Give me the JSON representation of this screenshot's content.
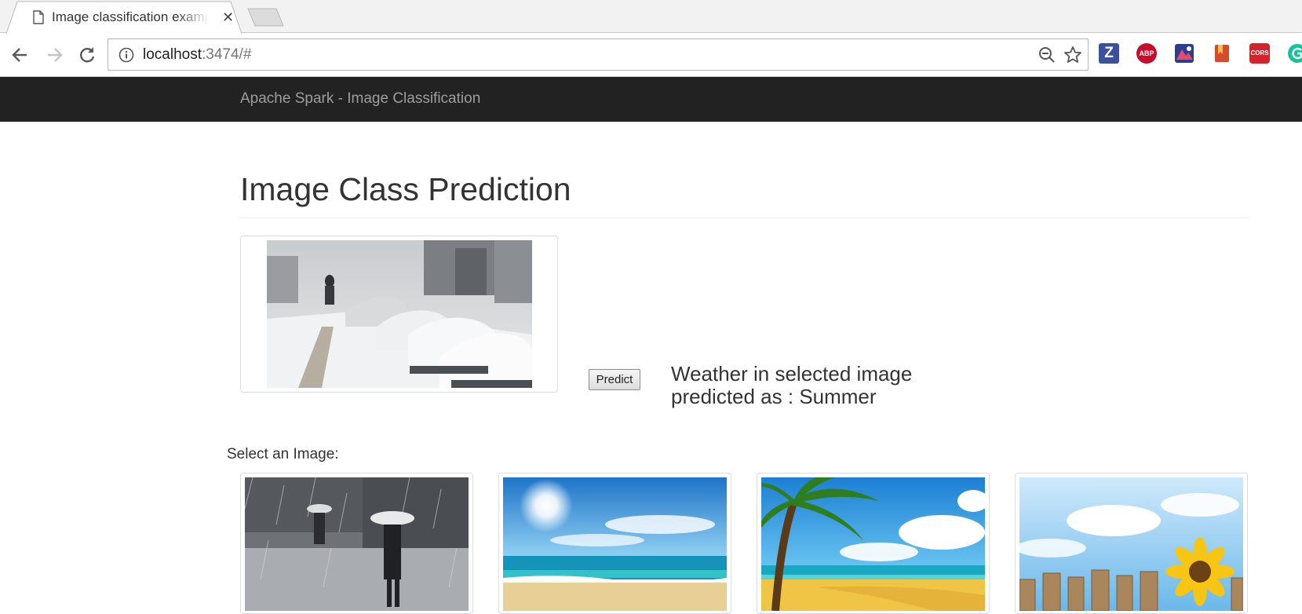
{
  "browser": {
    "tab_title": "Image classification example",
    "url_host": "localhost",
    "url_rest": ":3474/#",
    "extensions": [
      {
        "name": "z-extension-icon",
        "label": "Z",
        "color": "#3a4f9e"
      },
      {
        "name": "adblock-plus-icon",
        "label": "ABP",
        "color": "#c70d2c"
      },
      {
        "name": "extension-gallery-icon",
        "label": "",
        "color": "#2b3e8f"
      },
      {
        "name": "bookmark-extension-icon",
        "label": "",
        "color": "#d84a2b"
      },
      {
        "name": "cors-extension-icon",
        "label": "CORS",
        "color": "#d3242b"
      },
      {
        "name": "grammarly-icon",
        "label": "",
        "color": "#15c39a"
      }
    ]
  },
  "navbar": {
    "brand": "Apache Spark - Image Classification"
  },
  "main": {
    "title": "Image Class Prediction",
    "predict_button": "Predict",
    "result_text": "Weather in selected image predicted as : Summer",
    "select_label": "Select an Image:"
  },
  "images": {
    "selected": "snowy-street-image",
    "gallery": [
      "rainy-street-image",
      "sunny-beach-image",
      "palm-beach-image",
      "sunflower-fence-image"
    ]
  }
}
